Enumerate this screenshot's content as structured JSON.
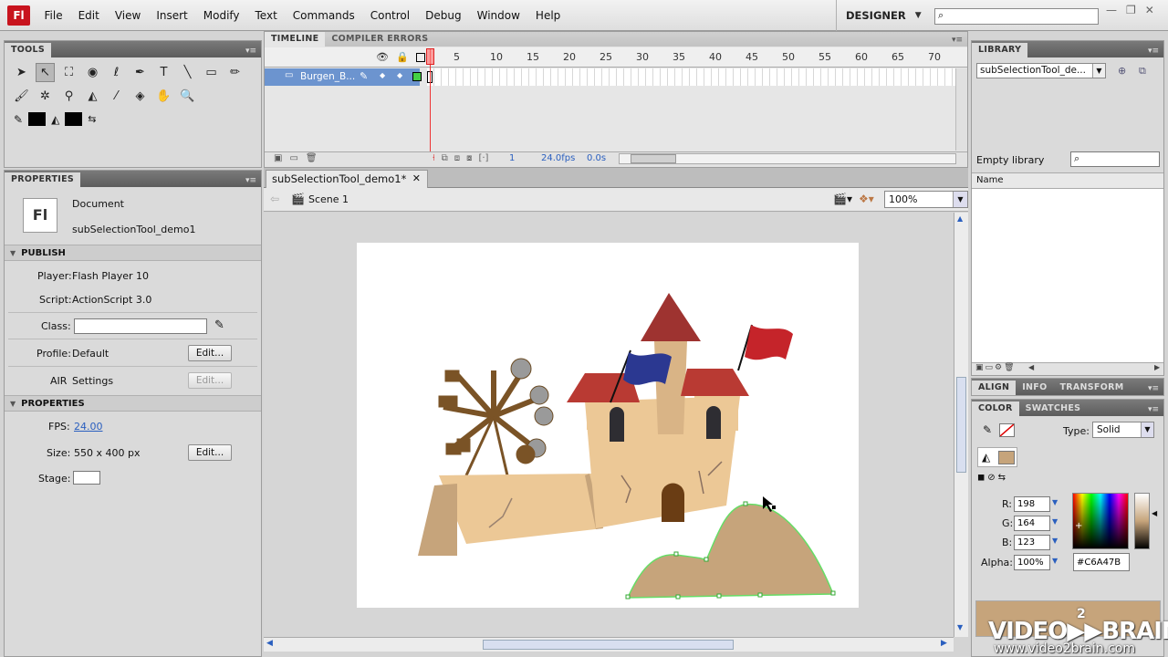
{
  "app": {
    "logo": "Fl",
    "workspace": "DESIGNER"
  },
  "menu": [
    "File",
    "Edit",
    "View",
    "Insert",
    "Modify",
    "Text",
    "Commands",
    "Control",
    "Debug",
    "Window",
    "Help"
  ],
  "tools": {
    "title": "TOOLS"
  },
  "timeline": {
    "tabs": [
      "TIMELINE",
      "COMPILER ERRORS"
    ],
    "ruler": [
      "5",
      "10",
      "15",
      "20",
      "25",
      "30",
      "35",
      "40",
      "45",
      "50",
      "55",
      "60",
      "65",
      "70"
    ],
    "layer": "Burgen_B...",
    "current_frame": "1",
    "fps": "24.0fps",
    "time": "0.0s"
  },
  "document_tab": "subSelectionTool_demo1*",
  "scene": "Scene 1",
  "zoom": "100%",
  "properties": {
    "title": "PROPERTIES",
    "type": "Document",
    "name": "subSelectionTool_demo1",
    "publish_section": "PUBLISH",
    "player_label": "Player:",
    "player": "Flash Player 10",
    "script_label": "Script:",
    "script": "ActionScript 3.0",
    "class_label": "Class:",
    "profile_label": "Profile:",
    "profile": "Default",
    "edit": "Edit...",
    "air_label": "AIR",
    "air": "Settings",
    "props_section": "PROPERTIES",
    "fps_label": "FPS:",
    "fps": "24.00",
    "size_label": "Size:",
    "size": "550 x 400 px",
    "stage_label": "Stage:"
  },
  "library": {
    "title": "LIBRARY",
    "doc": "subSelectionTool_de...",
    "empty": "Empty library",
    "column": "Name"
  },
  "align_tabs": [
    "ALIGN",
    "INFO",
    "TRANSFORM"
  ],
  "color": {
    "tabs": [
      "COLOR",
      "SWATCHES"
    ],
    "type_label": "Type:",
    "type": "Solid",
    "r_label": "R:",
    "r": "198",
    "g_label": "G:",
    "g": "164",
    "b_label": "B:",
    "b": "123",
    "alpha_label": "Alpha:",
    "alpha": "100%",
    "hex": "#C6A47B",
    "swatch": "#c6a47b"
  },
  "watermark": {
    "brand": "VIDEO▶▶BRAIN",
    "sup": "2",
    "url": "www.video2brain.com"
  }
}
